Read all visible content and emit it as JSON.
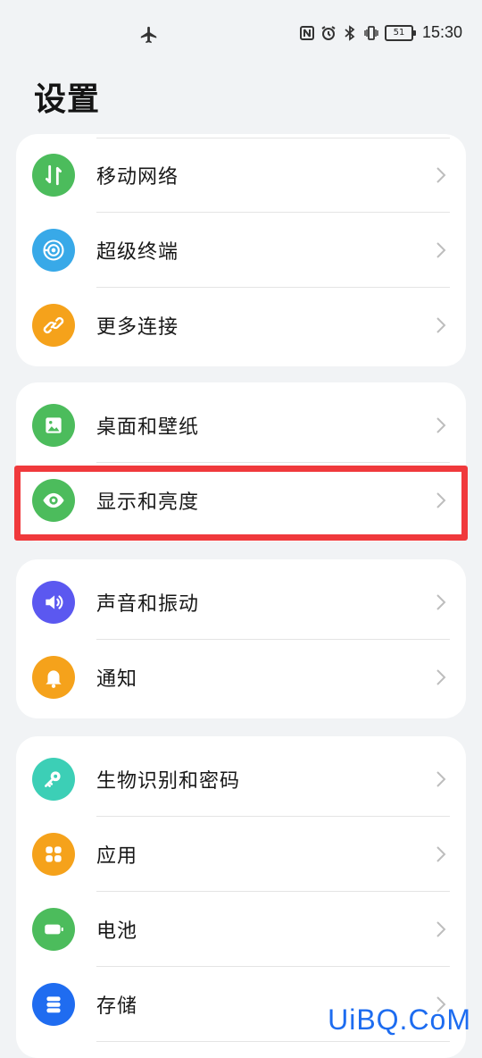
{
  "status_bar": {
    "time": "15:30",
    "battery": "51",
    "icons": [
      "airplane-icon",
      "nfc-icon",
      "alarm-icon",
      "bluetooth-icon",
      "vibrate-icon",
      "battery-icon"
    ]
  },
  "page": {
    "title": "设置"
  },
  "groups": [
    {
      "items": [
        {
          "label": "移动网络",
          "icon": "mobile-network-icon",
          "color": "#4cbc5c"
        },
        {
          "label": "超级终端",
          "icon": "super-device-icon",
          "color": "#38a9e8"
        },
        {
          "label": "更多连接",
          "icon": "link-icon",
          "color": "#f5a21b"
        }
      ]
    },
    {
      "items": [
        {
          "label": "桌面和壁纸",
          "icon": "wallpaper-icon",
          "color": "#4cbc5c"
        },
        {
          "label": "显示和亮度",
          "icon": "eye-icon",
          "color": "#4cbc5c"
        }
      ]
    },
    {
      "items": [
        {
          "label": "声音和振动",
          "icon": "speaker-icon",
          "color": "#5b58f0"
        },
        {
          "label": "通知",
          "icon": "bell-icon",
          "color": "#f5a21b"
        }
      ]
    },
    {
      "items": [
        {
          "label": "生物识别和密码",
          "icon": "key-icon",
          "color": "#3ccfb6"
        },
        {
          "label": "应用",
          "icon": "apps-icon",
          "color": "#f5a21b"
        },
        {
          "label": "电池",
          "icon": "battery-icon",
          "color": "#4cbc5c"
        },
        {
          "label": "存储",
          "icon": "storage-icon",
          "color": "#1f6cf0"
        }
      ]
    }
  ],
  "highlight_color": "#f0393c",
  "watermark": "UiBQ.CoM"
}
